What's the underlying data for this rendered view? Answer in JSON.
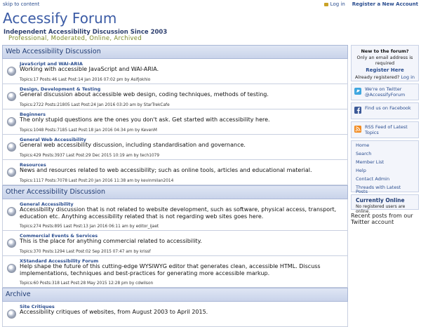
{
  "header": {
    "skip_link": "skip to content",
    "login": "Log in",
    "register_new": "Register a New Account",
    "site_title": "Accessify Forum",
    "tagline": "Independent Accessibility Discussion Since 2003",
    "subtagline": "Professional, Moderated, Online, Archived"
  },
  "sections": {
    "web": "Web Accessibility Discussion",
    "other": "Other Accessibility Discussion",
    "archive": "Archive"
  },
  "forums": [
    {
      "title": "JavaScript and WAI-ARIA",
      "desc": "Working with accessible JavaScript and WAI-ARIA.",
      "meta": "Topics:17   Posts:46   Last Post:14 Jan 2016 07:02 pm by Asifjokhio"
    },
    {
      "title": "Design, Development & Testing",
      "desc": "General discussion about accessible web design, coding techniques, methods of testing.",
      "meta": "Topics:2722   Posts:21805   Last Post:24 Jan 2016 03:20 am by StarTrekCafe"
    },
    {
      "title": "Beginners",
      "desc": "The only stupid questions are the ones you don't ask. Get started with accessibility here.",
      "meta": "Topics:1048   Posts:7185   Last Post:18 Jan 2016 04:34 pm by KevenM"
    },
    {
      "title": "General Web Accessibility",
      "desc": "General web accessibility discussion, including standardisation and governance.",
      "meta": "Topics:429   Posts:3937   Last Post:29 Dec 2015 10:19 am by tech1079"
    },
    {
      "title": "Resources",
      "desc": "News and resources related to web accessibility; such as online tools, articles and educational material.",
      "meta": "Topics:1117   Posts:7078   Last Post:20 Jan 2016 11:38 am by kevinmilan2014"
    },
    {
      "title": "General Accessibility",
      "desc": "Accessibility discussion that is not related to website development, such as software, physical access, transport, education etc. Anything accessibility related that is not regarding web sites goes here.",
      "meta": "Topics:274   Posts:895   Last Post:13 Jan 2016 06:11 am by editor_ijaet"
    },
    {
      "title": "Commercial Events & Services",
      "desc": "This is the place for anything commercial related to accessibility.",
      "meta": "Topics:370   Posts:1294   Last Post:02 Sep 2015 07:47 am by krissf"
    },
    {
      "title": "XStandard Accessibility Forum",
      "desc": "Help shape the future of this cutting-edge WYSIWYG editor that generates clean, accessible HTML. Discuss implementations, techniques and best-practices for generating more accessible markup.",
      "meta": "Topics:60   Posts:318   Last Post:28 May 2015 12:28 pm by cdwilson"
    },
    {
      "title": "Site Critiques",
      "desc": "Accessibility critiques of websites, from August 2003 to April 2015."
    }
  ],
  "sidebar": {
    "new_heading": "New to the forum?",
    "email_note": "Only an email address is required",
    "register_here": "Register Here",
    "already_registered": "Already registered?",
    "login": "Log in",
    "twitter": "We're on Twitter @AccessifyForum",
    "facebook": "Find us on Facebook",
    "rss": "RSS Feed of Latest Topics",
    "menu": [
      "Home",
      "Search",
      "Member List",
      "Help",
      "Contact Admin",
      "Threads with Latest Posts"
    ],
    "online_heading": "Currently Online",
    "online_text": "No registered users are online.",
    "recent": "Recent posts from our Twitter account"
  },
  "colors": {
    "accent": "#3b5ba5",
    "tagline_green": "#7b8a2a",
    "link": "#2a4d8f"
  }
}
